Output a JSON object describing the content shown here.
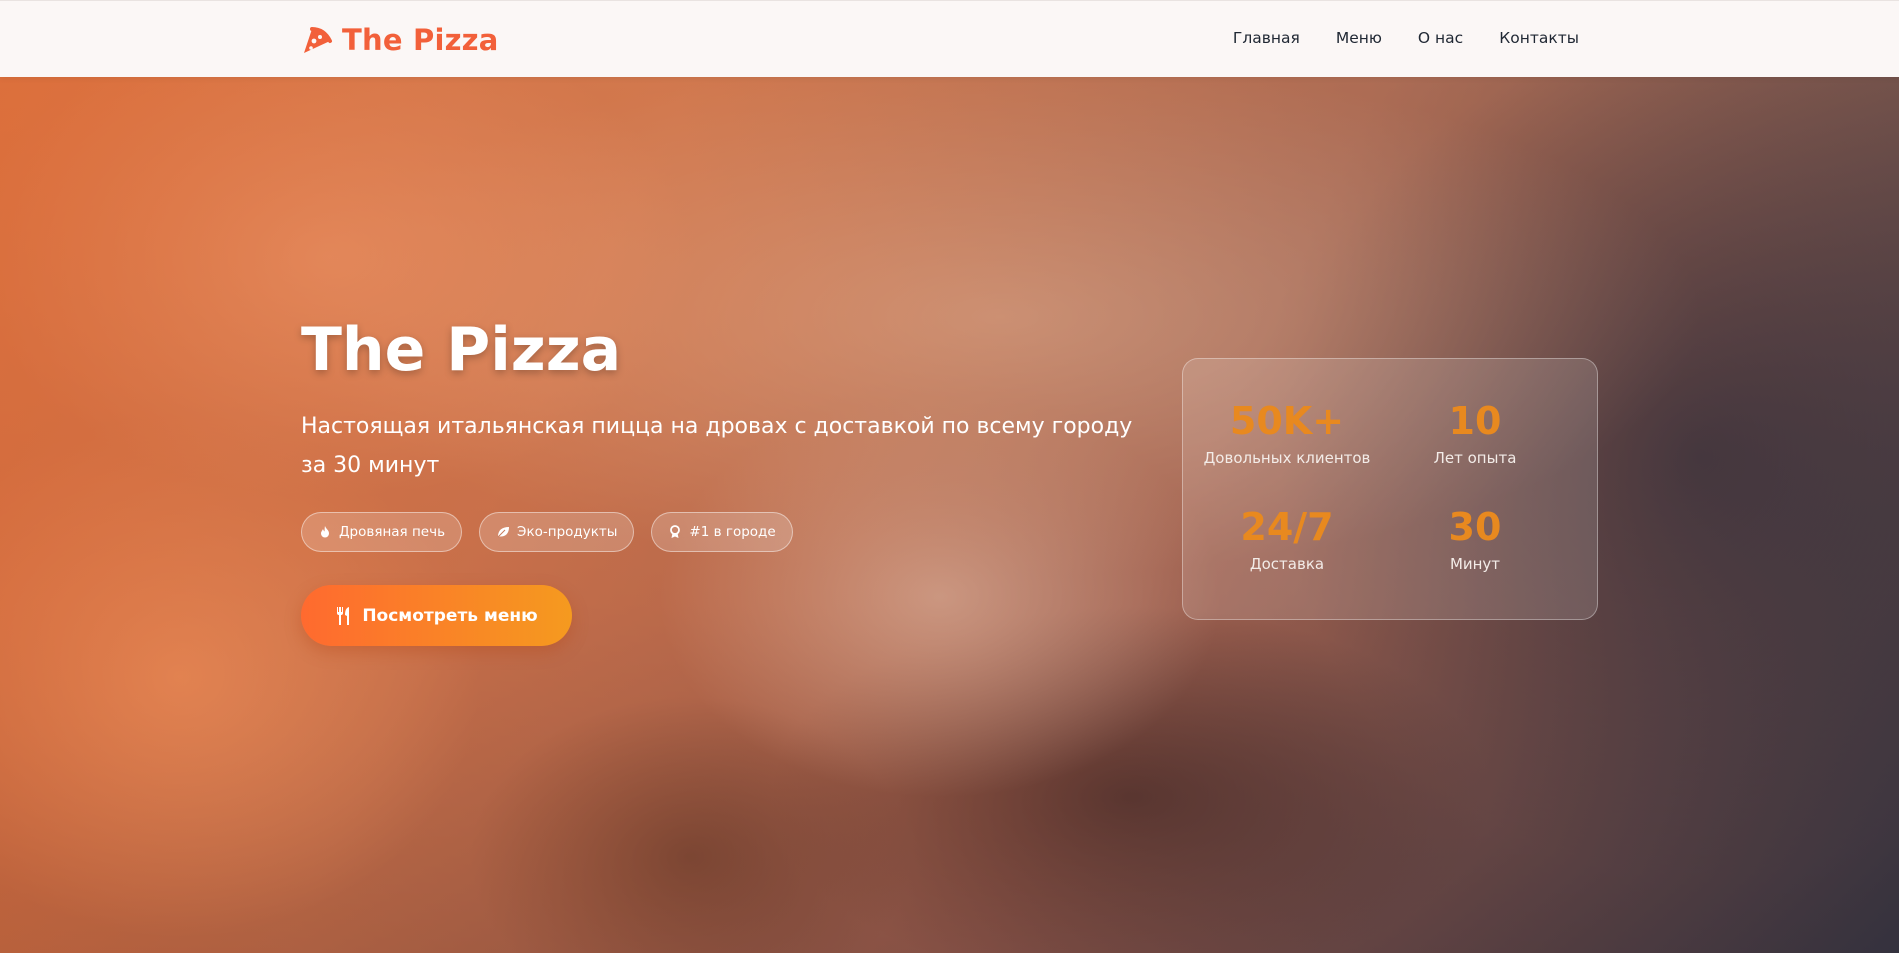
{
  "brand": {
    "name": "The Pizza",
    "icon": "pizza-slice-icon",
    "color": "#f2603a"
  },
  "nav": {
    "items": [
      "Главная",
      "Меню",
      "О нас",
      "Контакты"
    ]
  },
  "hero": {
    "title": "The Pizza",
    "subtitle": "Настоящая итальянская пицца на дровах с доставкой по всему городу за 30 минут",
    "badges": [
      {
        "label": "Дровяная печь",
        "icon": "fire-icon"
      },
      {
        "label": "Эко-продукты",
        "icon": "leaf-icon"
      },
      {
        "label": "#1 в городе",
        "icon": "award-icon"
      }
    ],
    "cta": {
      "label": "Посмотреть меню",
      "icon": "utensils-icon"
    }
  },
  "stats": [
    {
      "value": "50K+",
      "label": "Довольных клиентов"
    },
    {
      "value": "10",
      "label": "Лет опыта"
    },
    {
      "value": "24/7",
      "label": "Доставка"
    },
    {
      "value": "30",
      "label": "Минут"
    }
  ],
  "colors": {
    "accent": "#f2603a",
    "cta_start": "#ff6a2f",
    "cta_end": "#f59a1f",
    "stat_value": "#e8891f"
  }
}
